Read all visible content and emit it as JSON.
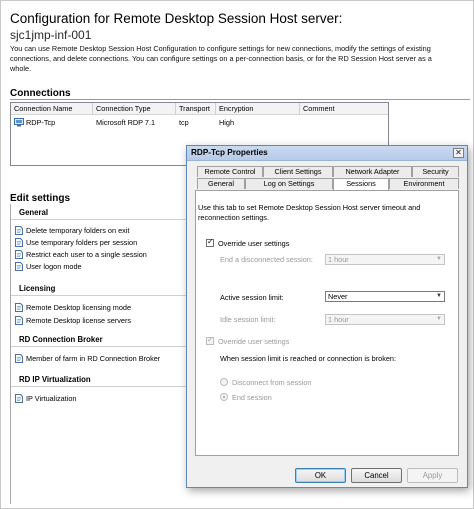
{
  "page": {
    "title": "Configuration for Remote Desktop Session Host server:",
    "server": "sjc1jmp-inf-001",
    "intro": "You can use Remote Desktop Session Host Configuration to configure settings for new connections, modify the settings of existing connections, and delete connections. You can configure settings on a per-connection basis, or for the RD Session Host server as a whole."
  },
  "connections": {
    "heading": "Connections",
    "columns": [
      "Connection Name",
      "Connection Type",
      "Transport",
      "Encryption",
      "Comment"
    ],
    "rows": [
      {
        "name": "RDP-Tcp",
        "type": "Microsoft RDP 7.1",
        "transport": "tcp",
        "encryption": "High",
        "comment": ""
      }
    ]
  },
  "edit_settings": {
    "heading": "Edit settings",
    "general": {
      "title": "General",
      "items": [
        "Delete temporary folders on exit",
        "Use temporary folders per session",
        "Restrict each user to a single session",
        "User logon mode"
      ]
    },
    "licensing": {
      "title": "Licensing",
      "items": [
        "Remote Desktop licensing mode",
        "Remote Desktop license servers"
      ]
    },
    "broker": {
      "title": "RD Connection Broker",
      "items": [
        "Member of farm in RD Connection Broker"
      ]
    },
    "ipvirt": {
      "title": "RD IP Virtualization",
      "items": [
        "IP Virtualization"
      ]
    }
  },
  "dialog": {
    "title": "RDP-Tcp Properties",
    "close_glyph": "✕",
    "tabs_back": [
      "Remote Control",
      "Client Settings",
      "Network Adapter",
      "Security"
    ],
    "tabs_front": [
      "General",
      "Log on Settings",
      "Sessions",
      "Environment"
    ],
    "active_tab": "Sessions",
    "description": "Use this tab to set Remote Desktop Session Host server timeout and reconnection settings.",
    "override1": {
      "label": "Override user settings",
      "checked": true
    },
    "end_disconnected": {
      "label": "End a disconnected session:",
      "value": "1 hour"
    },
    "active_limit": {
      "label": "Active session limit:",
      "value": "Never"
    },
    "idle_limit": {
      "label": "Idle session limit:",
      "value": "1 hour"
    },
    "override2": {
      "label": "Override user settings",
      "checked": true
    },
    "broken_label": "When session limit is reached or connection is broken:",
    "radio_disconnect": "Disconnect from session",
    "radio_end": "End session",
    "combo_arrow": "▼",
    "buttons": {
      "ok": "OK",
      "cancel": "Cancel",
      "apply": "Apply"
    }
  },
  "colors": {
    "title_bar": "#b6cbe8",
    "dialog_border": "#5f8ab8",
    "disabled_text": "#9a9a9a"
  }
}
